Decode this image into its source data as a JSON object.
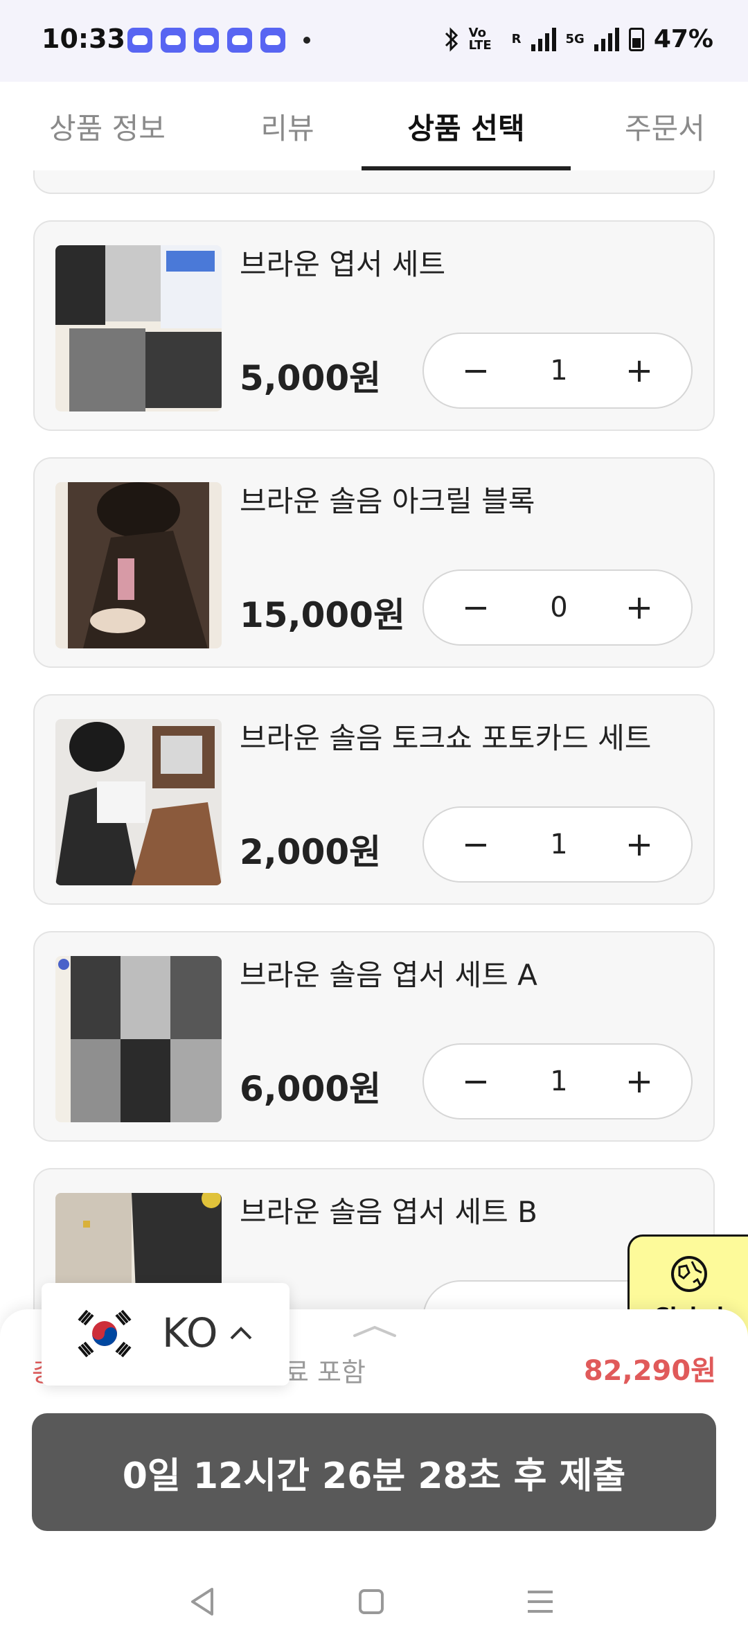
{
  "status_bar": {
    "time": "10:33",
    "notification_icons": [
      "discord-icon",
      "discord-icon",
      "discord-icon",
      "discord-icon",
      "discord-icon"
    ],
    "volte": "Vo LTE",
    "net_5g": "5G",
    "roaming": "R",
    "battery": "47%"
  },
  "tabs": [
    {
      "label": "상품 정보",
      "active": false
    },
    {
      "label": "리뷰",
      "active": false
    },
    {
      "label": "상품 선택",
      "active": true
    },
    {
      "label": "주문서",
      "active": false
    }
  ],
  "products": [
    {
      "title": "브라운 엽서 세트",
      "price": "5,000원",
      "quantity": "1"
    },
    {
      "title": "브라운 솔음 아크릴 블록",
      "price": "15,000원",
      "quantity": "0"
    },
    {
      "title": "브라운 솔음 토크쇼 포토카드 세트",
      "price": "2,000원",
      "quantity": "1"
    },
    {
      "title": "브라운 솔음 엽서 세트 A",
      "price": "6,000원",
      "quantity": "1"
    },
    {
      "title": "브라운 솔음 엽서 세트 B",
      "price": "",
      "quantity": ""
    }
  ],
  "stepper": {
    "minus": "−",
    "plus": "+"
  },
  "summary": {
    "total_label_prefix": "총",
    "total_label_suffix": "료 포함",
    "total_value": "82,290원"
  },
  "submit": {
    "label": "0일 12시간 26분 28초 후 제출"
  },
  "language": {
    "code": "KO"
  },
  "global_button": {
    "label": "Global"
  },
  "colors": {
    "accent_red": "#e05a5a",
    "submit_bg": "#595959",
    "global_bg": "#fdfa9a"
  }
}
